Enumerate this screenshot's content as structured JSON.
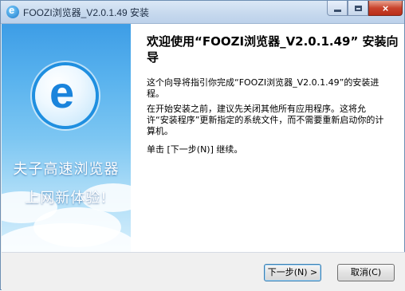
{
  "window": {
    "title": "FOOZI浏览器_V2.0.1.49 安装",
    "controls": {
      "minimize": "minimize",
      "maximize": "maximize",
      "close": "×"
    }
  },
  "banner": {
    "logo_letter": "e",
    "slogan_line1": "夫子高速浏览器",
    "slogan_line2": "上网新体验!"
  },
  "content": {
    "heading": "欢迎使用“FOOZI浏览器_V2.0.1.49” 安装向导",
    "para1": "这个向导将指引你完成“FOOZI浏览器_V2.0.1.49”的安装进程。",
    "para2": "在开始安装之前，建议先关闭其他所有应用程序。这将允许“安装程序”更新指定的系统文件，而不需要重新启动你的计算机。",
    "para3": "单击 [下一步(N)] 继续。"
  },
  "footer": {
    "next_label": "下一步(N) >",
    "cancel_label": "取消(C)"
  },
  "colors": {
    "accent": "#1a84dc",
    "banner_top": "#3d9de6"
  }
}
